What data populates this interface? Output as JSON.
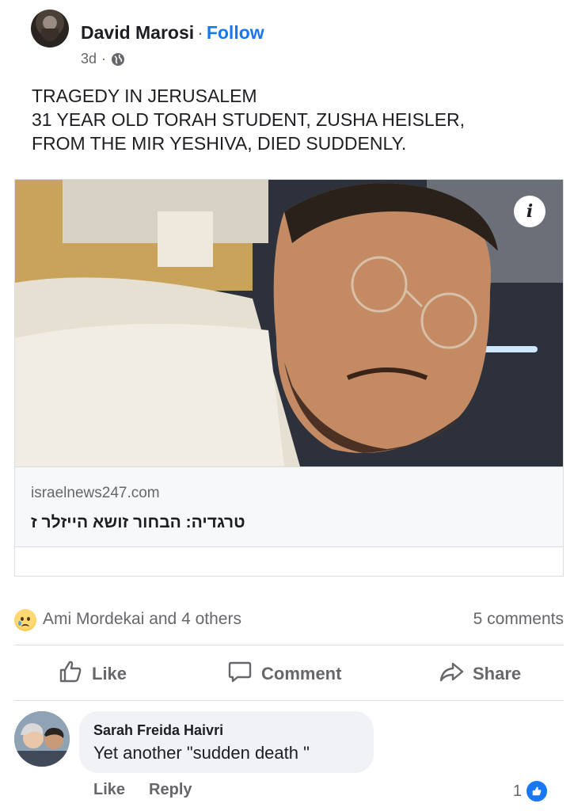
{
  "post": {
    "author": "David Marosi",
    "separator": "·",
    "follow_label": "Follow",
    "time": "3d",
    "time_separator": "·",
    "privacy_icon": "globe-icon",
    "text_lines": [
      "TRAGEDY IN JERUSALEM",
      "31 YEAR OLD TORAH STUDENT, ZUSHA HEISLER,",
      "FROM THE MIR YESHIVA, DIED SUDDENLY."
    ]
  },
  "link_preview": {
    "info_label": "i",
    "domain": "israelnews247.com",
    "title": "טרגדיה: הבחור זושא הייזלר ז"
  },
  "reactions": {
    "icon": "sad-emoji-icon",
    "reactors": "Ami Mordekai and 4 others",
    "comments_count": "5 comments"
  },
  "actions": {
    "like": "Like",
    "comment": "Comment",
    "share": "Share"
  },
  "comment": {
    "author": "Sarah Freida Haivri",
    "text": "Yet another \"sudden death \"",
    "like_label": "Like",
    "reply_label": "Reply",
    "like_count": "1"
  },
  "colors": {
    "accent": "#1877f2",
    "secondary_text": "#65676b",
    "bubble": "#f0f2f5"
  }
}
